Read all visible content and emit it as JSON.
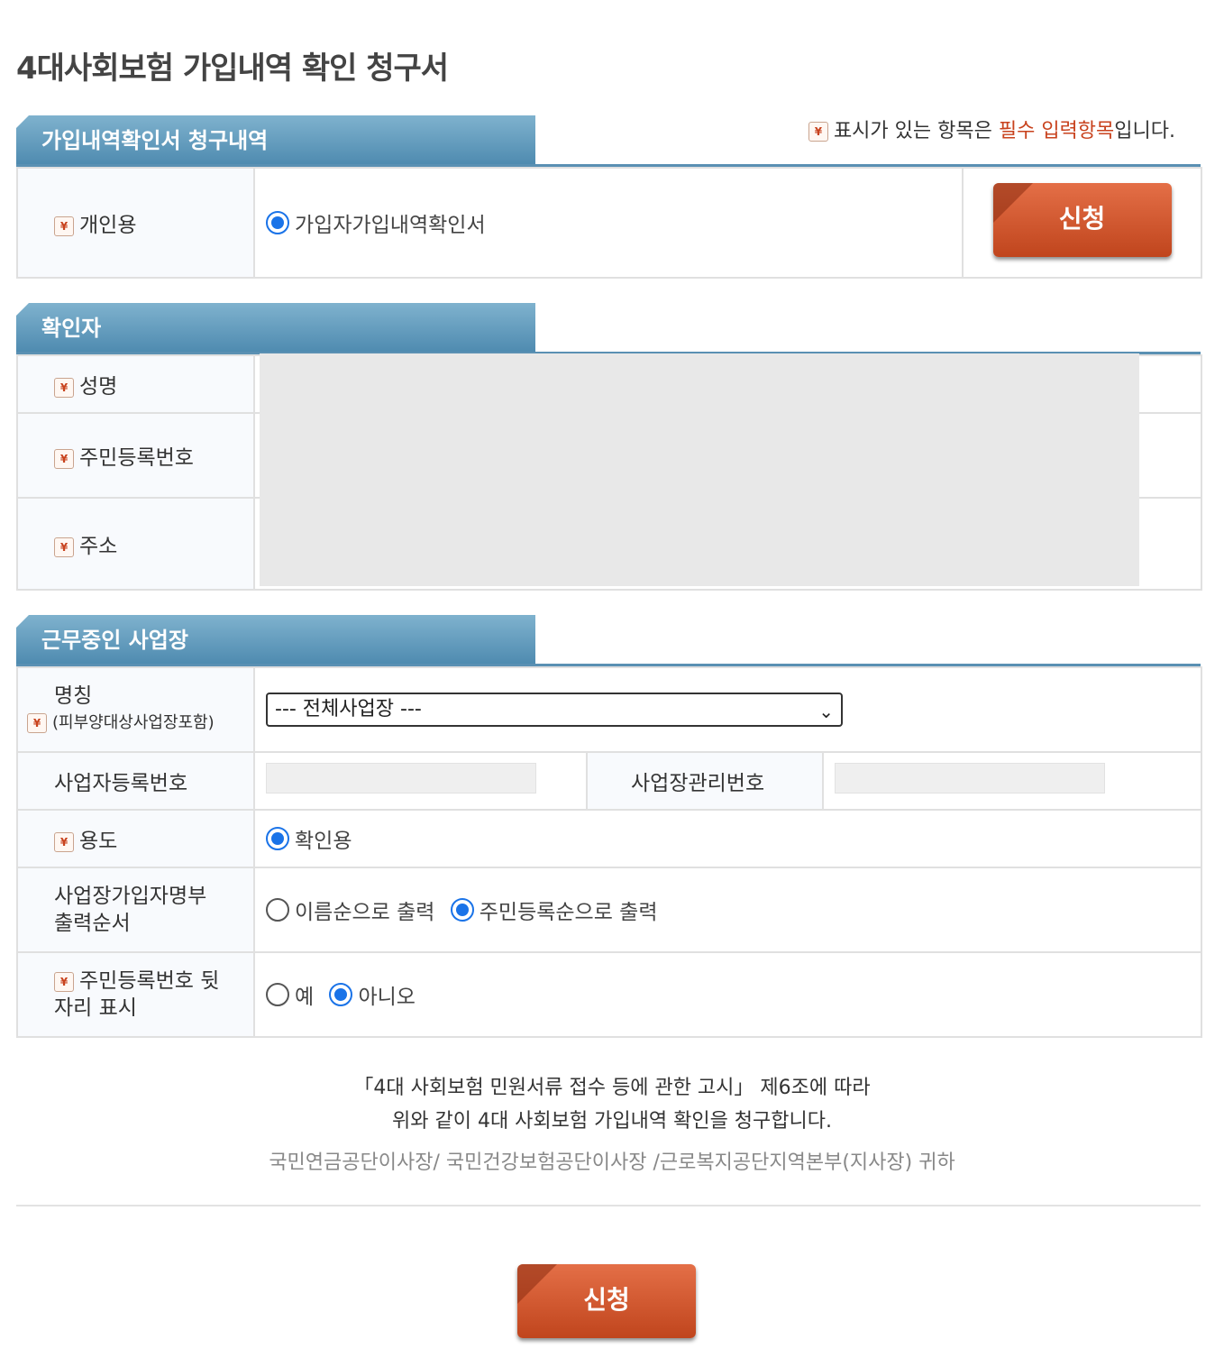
{
  "page_title": "4대사회보험 가입내역 확인 청구서",
  "required_note": {
    "prefix": "표시가 있는 항목은 ",
    "highlight": "필수 입력항목",
    "suffix": "입니다."
  },
  "required_icon": "required-icon",
  "section1": {
    "tab": "가입내역확인서 청구내역",
    "label": "개인용",
    "option": "가입자가입내역확인서",
    "apply_button": "신청"
  },
  "section2": {
    "tab": "확인자",
    "rows": [
      "성명",
      "주민등록번호",
      "주소"
    ]
  },
  "section3": {
    "tab": "근무중인 사업장",
    "name_label": "명칭",
    "name_sublabel": "(피부양대상사업장포함)",
    "name_select": "--- 전체사업장 ---",
    "biz_reg_label": "사업자등록번호",
    "biz_mgmt_label": "사업장관리번호",
    "purpose_label": "용도",
    "purpose_option": "확인용",
    "order_label_1": "사업장가입자명부",
    "order_label_2": "출력순서",
    "order_option_1": "이름순으로 출력",
    "order_option_2": "주민등록순으로 출력",
    "rrn_label_1": "주민등록번호 뒷",
    "rrn_label_2": "자리 표시",
    "rrn_yes": "예",
    "rrn_no": "아니오"
  },
  "notice": {
    "line1": "「4대 사회보험 민원서류 접수 등에 관한 고시」 제6조에 따라",
    "line2": "위와 같이 4대 사회보험 가입내역 확인을 청구합니다.",
    "line3": "국민연금공단이사장/ 국민건강보험공단이사장 /근로복지공단지역본부(지사장) 귀하"
  },
  "bottom_apply_button": "신청"
}
